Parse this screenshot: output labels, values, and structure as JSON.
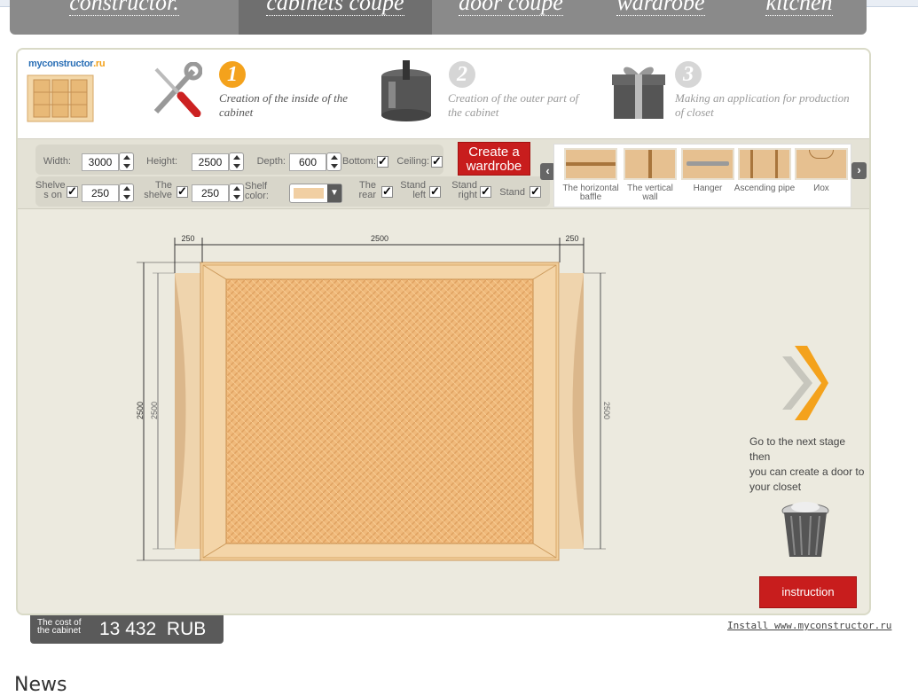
{
  "tabs": [
    {
      "label": "constructor.",
      "active": false
    },
    {
      "label": "cabinets coupe",
      "active": true
    },
    {
      "label": "door coupe",
      "active": false
    },
    {
      "label": "wardrobe",
      "active": false
    },
    {
      "label": "kitchen",
      "active": false
    }
  ],
  "logo": {
    "name": "myconstructor",
    "suffix": ".ru"
  },
  "steps": [
    {
      "number": "1",
      "text": "Creation of the inside of the cabinet",
      "active": true
    },
    {
      "number": "2",
      "text": "Creation of the outer part of the cabinet",
      "active": false
    },
    {
      "number": "3",
      "text": "Making an application for production of closet",
      "active": false
    }
  ],
  "controls": {
    "width_label": "Width:",
    "width_value": "3000",
    "height_label": "Height:",
    "height_value": "2500",
    "depth_label": "Depth:",
    "depth_value": "600",
    "bottom_label": "Bottom:",
    "bottom_checked": true,
    "ceiling_label": "Ceiling:",
    "ceiling_checked": true,
    "shelves_label_1": "Shelve",
    "shelves_label_2": "s on",
    "shelves_value": "250",
    "shelve_label_1": "The",
    "shelve_label_2": "shelve",
    "shelve_value": "250",
    "shelf_color_label": "Shelf color:",
    "shelf_color": "#f1cfa3",
    "rear_label_1": "The",
    "rear_label_2": "rear",
    "stand_left_label_1": "Stand",
    "stand_left_label_2": "left",
    "stand_right_label_1": "Stand",
    "stand_right_label_2": "right",
    "stand_label": "Stand"
  },
  "create_button": {
    "line1": "Create a",
    "line2": "wardrobe"
  },
  "parts": [
    {
      "label_1": "The horizontal",
      "label_2": "baffle",
      "icon": "horizontal-baffle-icon"
    },
    {
      "label_1": "The vertical",
      "label_2": "wall",
      "icon": "vertical-wall-icon"
    },
    {
      "label_1": "Hanger",
      "label_2": "",
      "icon": "hanger-icon"
    },
    {
      "label_1": "Ascending pipe",
      "label_2": "",
      "icon": "ascending-pipe-icon"
    },
    {
      "label_1": "Иох",
      "label_2": "",
      "icon": "box-icon"
    }
  ],
  "dimensions": {
    "left_side": "250",
    "width": "2500",
    "right_side": "250",
    "outer_height": "2500",
    "inner_height": "2500",
    "right_height": "2500"
  },
  "hint": {
    "line1": "Go to the next stage then",
    "line2": "you can create a door to",
    "line3": "your closet"
  },
  "instruction_button": "instruction",
  "cost": {
    "label_1": "The cost of",
    "label_2": "the cabinet",
    "value": "13 432",
    "currency": "RUB"
  },
  "install_link": "Install www.myconstructor.ru",
  "news_heading": "News",
  "colors": {
    "accent_red": "#c81d1d",
    "step_orange": "#f4a21c",
    "wood": "#f1cfa3",
    "wood_dark": "#e2a660"
  }
}
